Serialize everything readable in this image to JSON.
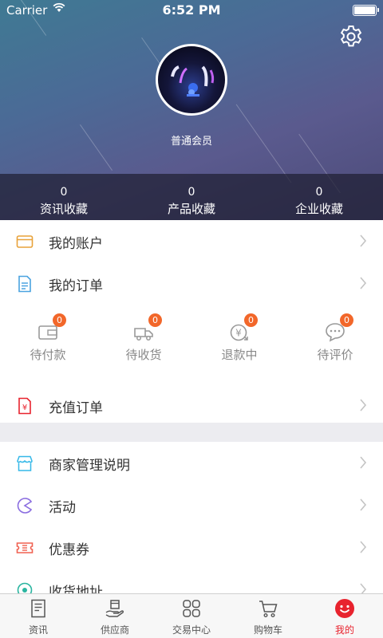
{
  "status_bar": {
    "carrier": "Carrier",
    "time": "6:52 PM"
  },
  "profile": {
    "member_level": "普通会员"
  },
  "stats": [
    {
      "count": "0",
      "label": "资讯收藏"
    },
    {
      "count": "0",
      "label": "产品收藏"
    },
    {
      "count": "0",
      "label": "企业收藏"
    }
  ],
  "menu": {
    "account": "我的账户",
    "orders": "我的订单",
    "recharge": "充值订单",
    "merchant": "商家管理说明",
    "activity": "活动",
    "coupon": "优惠券",
    "address": "收货地址"
  },
  "order_status": [
    {
      "label": "待付款",
      "badge": "0"
    },
    {
      "label": "待收货",
      "badge": "0"
    },
    {
      "label": "退款中",
      "badge": "0"
    },
    {
      "label": "待评价",
      "badge": "0"
    }
  ],
  "tabs": [
    {
      "label": "资讯"
    },
    {
      "label": "供应商"
    },
    {
      "label": "交易中心"
    },
    {
      "label": "购物车"
    },
    {
      "label": "我的"
    }
  ],
  "colors": {
    "accent": "#e8232e",
    "badge": "#f2672a",
    "account_icon": "#e8a23a",
    "orders_icon": "#4aa3e0",
    "recharge_icon": "#e8232e",
    "merchant_icon": "#35b8e8",
    "activity_icon": "#8a6de0",
    "coupon_icon": "#f06050",
    "address_icon": "#2bb5a0"
  },
  "icons": {
    "settings": "gear-icon",
    "account": "card-icon",
    "orders": "document-icon",
    "recharge": "yen-document-icon",
    "merchant": "store-icon",
    "activity": "pacman-icon",
    "coupon": "ticket-icon",
    "address": "location-icon"
  }
}
